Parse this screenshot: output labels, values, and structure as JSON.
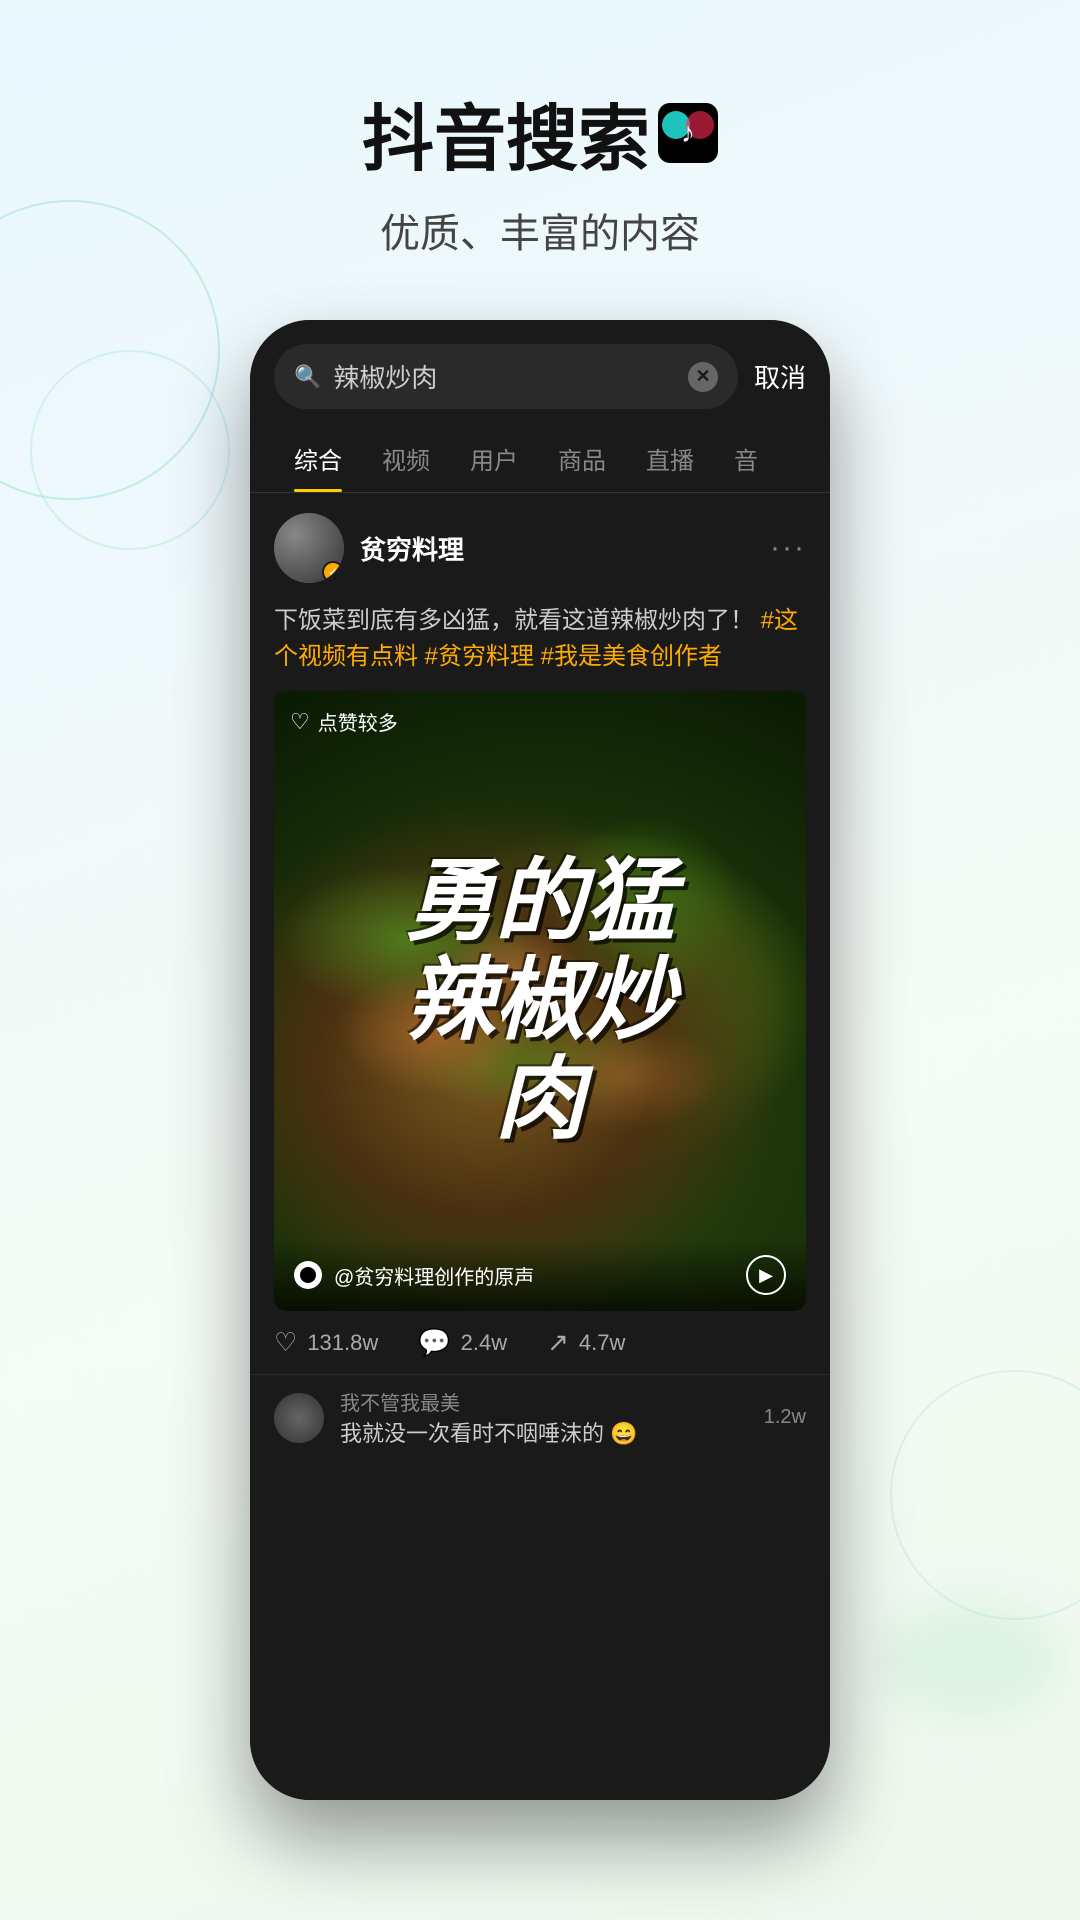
{
  "app": {
    "title": "抖音搜索",
    "title_icon": "♪",
    "subtitle": "优质、丰富的内容"
  },
  "phone": {
    "search": {
      "query": "辣椒炒肉",
      "cancel_label": "取消",
      "placeholder": "辣椒炒肉"
    },
    "tabs": [
      {
        "label": "综合",
        "active": true
      },
      {
        "label": "视频",
        "active": false
      },
      {
        "label": "用户",
        "active": false
      },
      {
        "label": "商品",
        "active": false
      },
      {
        "label": "直播",
        "active": false
      },
      {
        "label": "音",
        "active": false
      }
    ],
    "post": {
      "username": "贫穷料理",
      "verified": true,
      "caption_plain": "下饭菜到底有多凶猛，就看这道辣椒炒肉了！",
      "tags": "#这个视频有点料 #贫穷料理 #我是美食创作者",
      "video": {
        "badge": "点赞较多",
        "title_line1": "勇",
        "title_line2": "的猛",
        "title_line3": "辣",
        "title_line4": "椒炒",
        "title_line5": "肉",
        "big_text": "勇的猛辣椒炒肉",
        "sound": "@贫穷料理创作的原声"
      },
      "stats": {
        "likes": "131.8w",
        "comments": "2.4w",
        "shares": "4.7w"
      },
      "comment": {
        "user": "我不管我最美",
        "text": "我就没一次看时不咽唾沫的 😄",
        "likes": "1.2w"
      }
    }
  }
}
